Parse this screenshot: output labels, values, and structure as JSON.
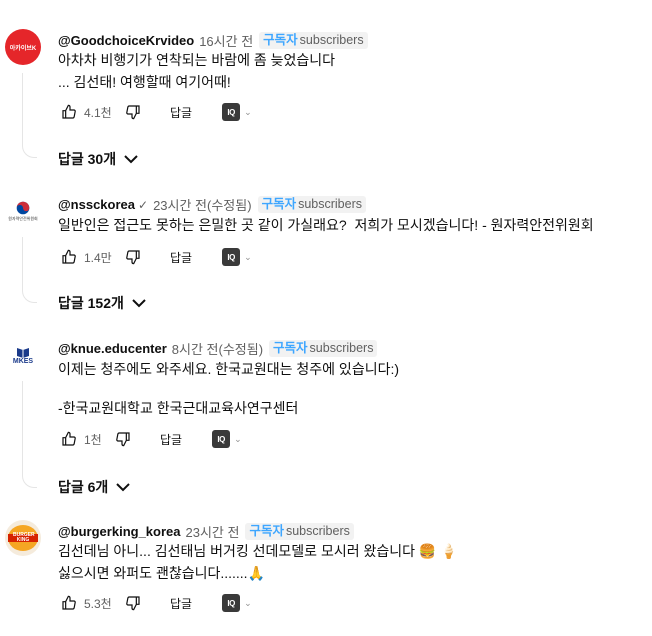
{
  "comments": [
    {
      "avatar_text": "아카이브K",
      "avatar_color": "#e5262a",
      "handle": "@GoodchoiceKrvideo",
      "verified": "",
      "time": "16시간 전",
      "sub_ko": "구독자",
      "sub_en": "subscribers",
      "lines": [
        "아차차 비행기가 연착되는 바람에 좀 늦었습니다",
        "... 김선태! 여행할때 여기어때!"
      ],
      "likes": "4.1천",
      "reply_label": "답글",
      "iq_label": "IQ",
      "replies_label": "답글 30개"
    },
    {
      "avatar_text": "원자력안전위원회",
      "avatar_color": "#ffffff",
      "handle": "@nssckorea",
      "verified": "✓",
      "time": "23시간 전(수정됨)",
      "sub_ko": "구독자",
      "sub_en": "subscribers",
      "lines": [
        "일반인은 접근도 못하는 은밀한 곳 같이 가실래요?  저희가 모시겠습니다! - 원자력안전위원회"
      ],
      "likes": "1.4만",
      "reply_label": "답글",
      "iq_label": "IQ",
      "replies_label": "답글 152개"
    },
    {
      "avatar_text": "MKES",
      "avatar_color": "#ffffff",
      "handle": "@knue.educenter",
      "verified": "",
      "time": "8시간 전(수정됨)",
      "sub_ko": "구독자",
      "sub_en": "subscribers",
      "lines": [
        "이제는 청주에도 와주세요. 한국교원대는 청주에 있습니다:)",
        "",
        "-한국교원대학교 한국근대교육사연구센터"
      ],
      "likes": "1천",
      "reply_label": "답글",
      "iq_label": "IQ",
      "replies_label": "답글 6개"
    },
    {
      "avatar_text": "BURGER KING",
      "avatar_color": "#f5ebdc",
      "handle": "@burgerking_korea",
      "verified": "",
      "time": "23시간 전",
      "sub_ko": "구독자",
      "sub_en": "subscribers",
      "lines": [
        "김선데님 아니... 김선태님 버거킹 선데모델로 모시러 왔습니다 🍔 🍦",
        "싫으시면 와퍼도 괜찮습니다.......🙏"
      ],
      "likes": "5.3천",
      "reply_label": "답글",
      "iq_label": "IQ",
      "replies_label": ""
    }
  ]
}
